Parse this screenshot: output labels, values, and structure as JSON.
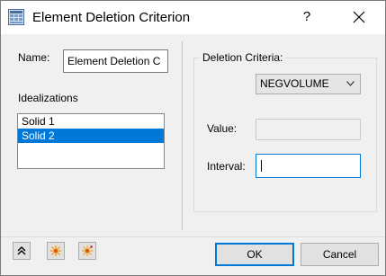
{
  "window": {
    "title": "Element Deletion Criterion",
    "help_label": "?",
    "icons": {
      "app": "app-icon",
      "close": "close-icon"
    }
  },
  "left_panel": {
    "name_label": "Name:",
    "name_value": "Element Deletion C",
    "idealizations_label": "Idealizations",
    "idealizations": [
      {
        "label": "Solid 1",
        "selected": false
      },
      {
        "label": "Solid 2",
        "selected": true
      }
    ]
  },
  "right_panel": {
    "group_title": "Deletion Criteria:",
    "criteria_selected": "NEGVOLUME",
    "value_label": "Value:",
    "value_value": "",
    "interval_label": "Interval:",
    "interval_value": ""
  },
  "footer": {
    "tool_icons": [
      "collapse-up-icon",
      "sparkle-icon",
      "sparkle-multi-icon"
    ],
    "ok_label": "OK",
    "cancel_label": "Cancel"
  },
  "colors": {
    "selection": "#0078d7",
    "focus_border": "#0078d7",
    "sparkle": "#f0a020"
  }
}
